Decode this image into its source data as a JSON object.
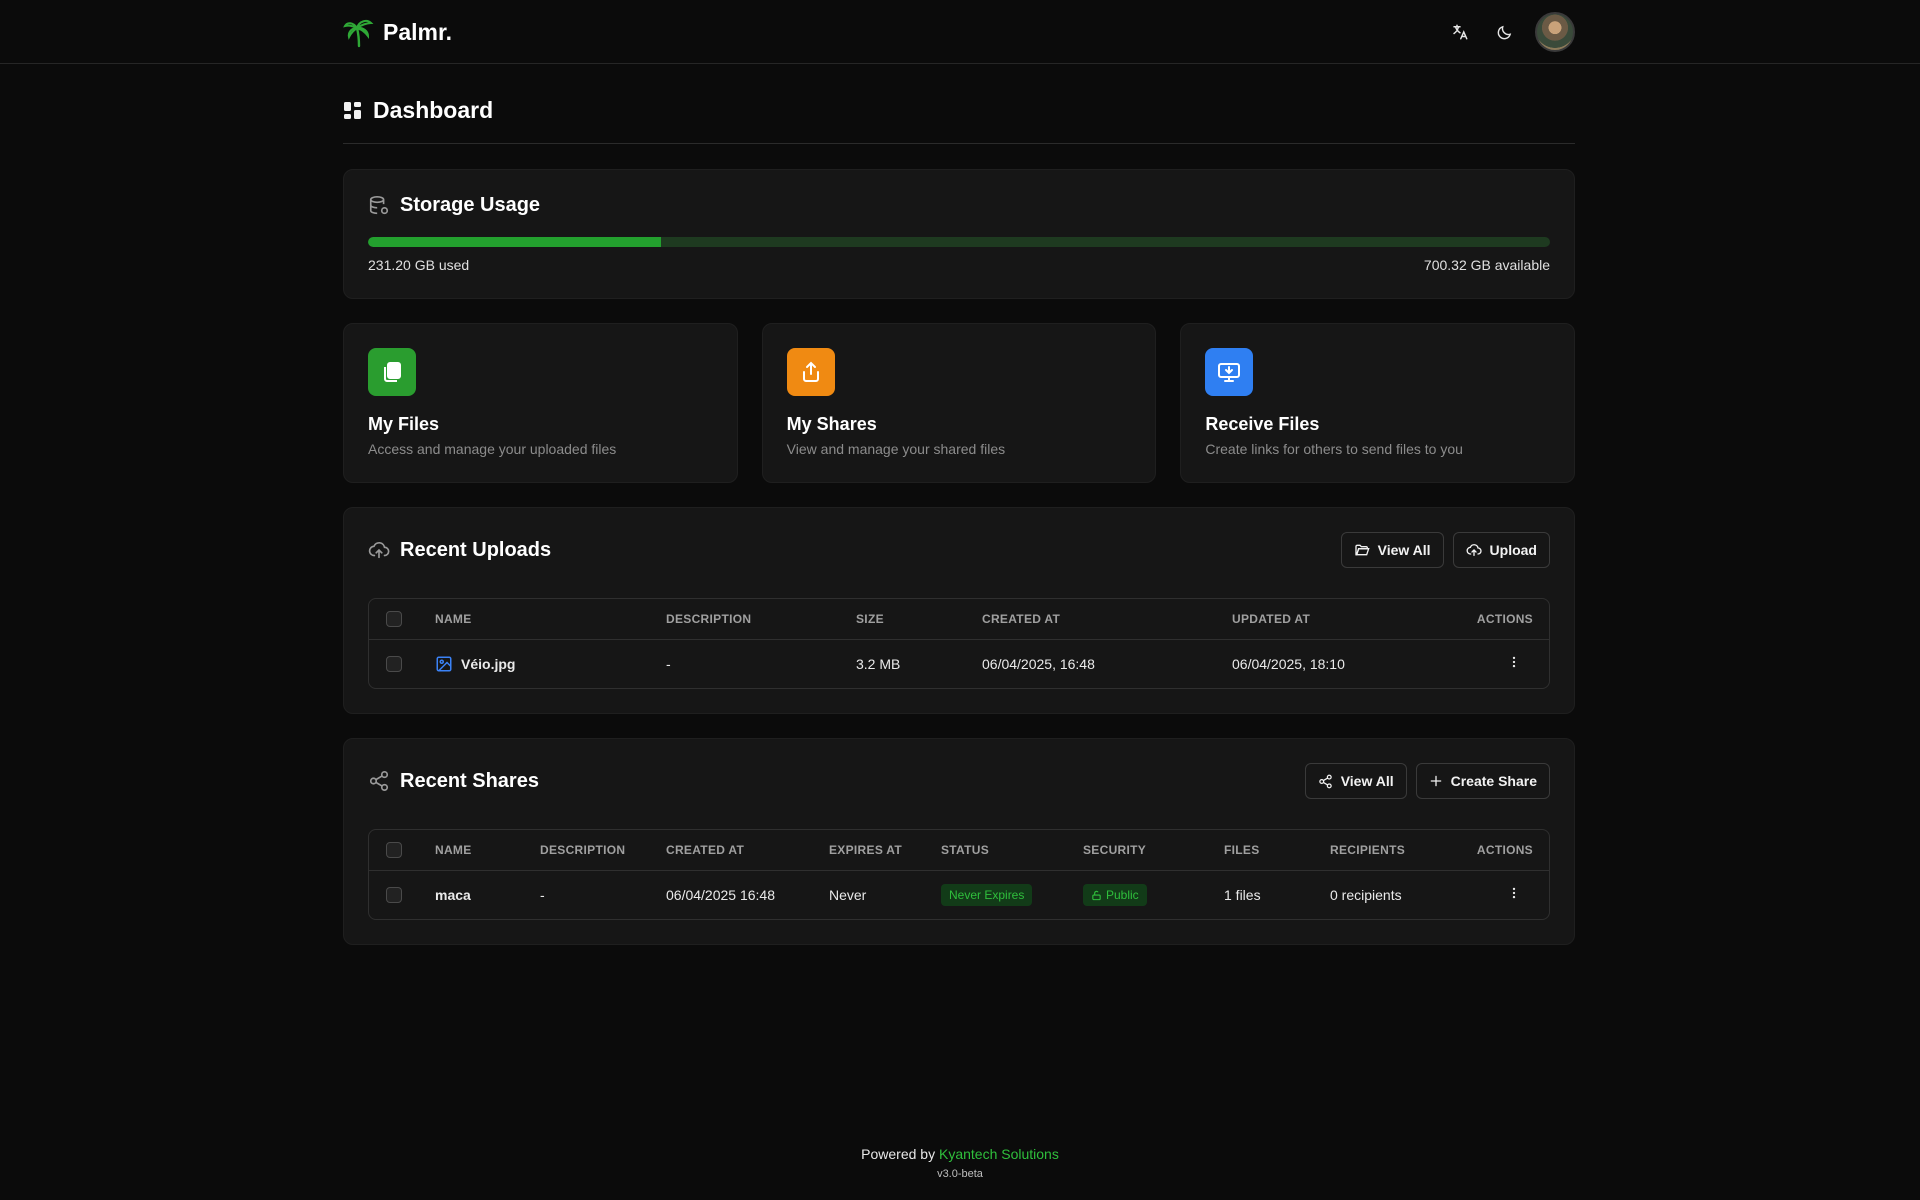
{
  "app": {
    "name": "Palmr."
  },
  "header": {
    "translate_icon": "translate-icon",
    "theme_icon": "moon-icon"
  },
  "page": {
    "title": "Dashboard"
  },
  "storage": {
    "title": "Storage Usage",
    "used_label": "231.20 GB used",
    "available_label": "700.32 GB available",
    "used_fraction": 0.248
  },
  "quick_actions": [
    {
      "title": "My Files",
      "description": "Access and manage your uploaded files",
      "color": "#2a9d2f",
      "icon": "files-icon"
    },
    {
      "title": "My Shares",
      "description": "View and manage your shared files",
      "color": "#f08a12",
      "icon": "share-upload-icon"
    },
    {
      "title": "Receive Files",
      "description": "Create links for others to send files to you",
      "color": "#2f7ff2",
      "icon": "monitor-download-icon"
    }
  ],
  "uploads": {
    "title": "Recent Uploads",
    "view_all": "View All",
    "upload": "Upload",
    "columns": [
      "NAME",
      "DESCRIPTION",
      "SIZE",
      "CREATED AT",
      "UPDATED AT",
      "ACTIONS"
    ],
    "rows": [
      {
        "name": "Véio.jpg",
        "description": "-",
        "size": "3.2 MB",
        "created_at": "06/04/2025, 16:48",
        "updated_at": "06/04/2025, 18:10"
      }
    ]
  },
  "shares": {
    "title": "Recent Shares",
    "view_all": "View All",
    "create": "Create Share",
    "columns": [
      "NAME",
      "DESCRIPTION",
      "CREATED AT",
      "EXPIRES AT",
      "STATUS",
      "SECURITY",
      "FILES",
      "RECIPIENTS",
      "ACTIONS"
    ],
    "rows": [
      {
        "name": "maca",
        "description": "-",
        "created_at": "06/04/2025 16:48",
        "expires_at": "Never",
        "status": "Never Expires",
        "security": "Public",
        "files": "1 files",
        "recipients": "0 recipients"
      }
    ]
  },
  "footer": {
    "powered_by": "Powered by",
    "company": "Kyantech Solutions",
    "version": "v3.0-beta"
  },
  "colors": {
    "accent": "#2fbf3c",
    "background": "#0b0b0b",
    "card": "#161616"
  }
}
